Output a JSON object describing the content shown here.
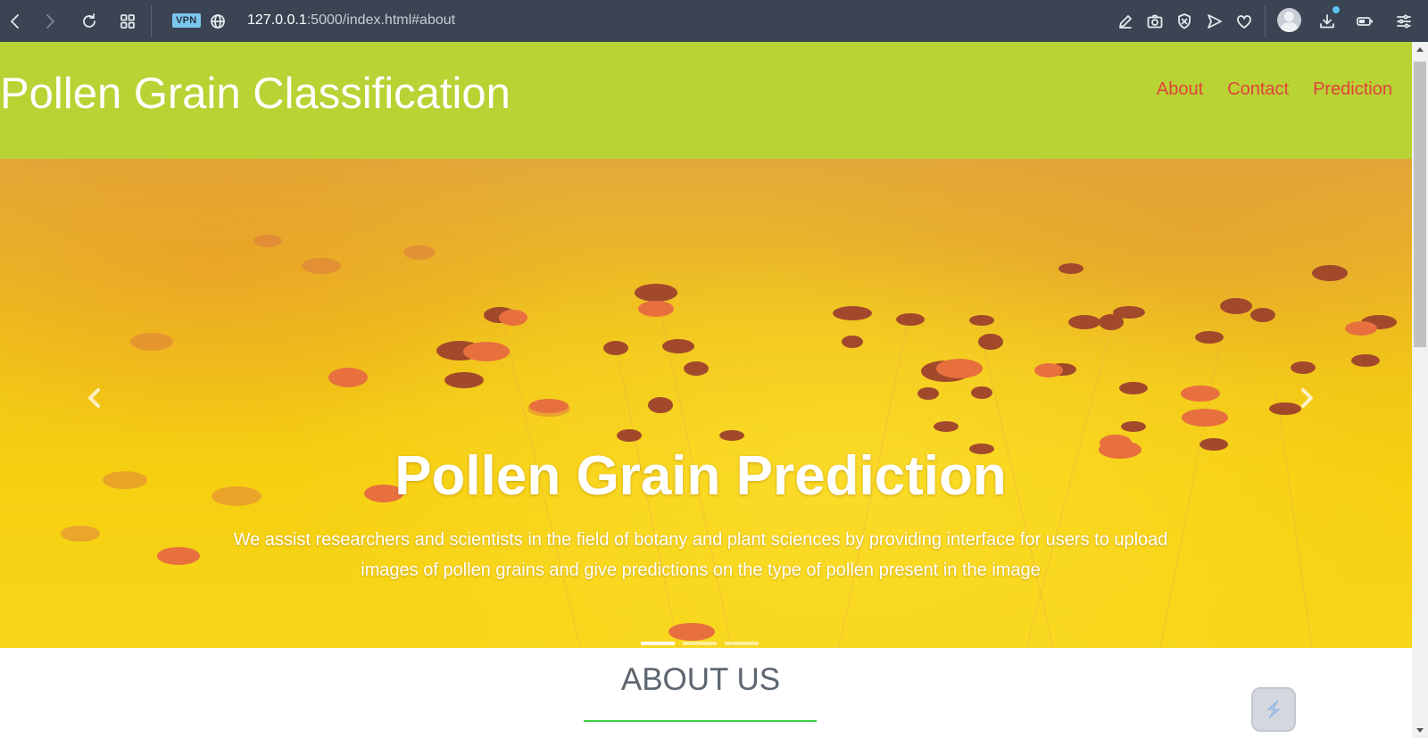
{
  "browser": {
    "vpn_label": "VPN",
    "url_host": "127.0.0.1",
    "url_rest": ":5000/index.html#about",
    "icons": [
      "back-icon",
      "forward-icon",
      "reload-icon",
      "tabs-grid-icon",
      "globe-icon",
      "edit-icon",
      "camera-icon",
      "shield-icon",
      "send-icon",
      "heart-icon",
      "avatar",
      "download-icon",
      "battery-icon",
      "settings-icon"
    ]
  },
  "site": {
    "brand": "Pollen Grain Classification",
    "nav": [
      "About",
      "Contact",
      "Prediction"
    ]
  },
  "hero": {
    "title": "Pollen Grain Prediction",
    "description": "We assist researchers and scientists in the field of botany and plant sciences by providing interface for users to upload images of pollen grains and give predictions on the type of pollen present in the image",
    "slide_count": 3,
    "active_slide": 1
  },
  "about": {
    "title": "ABOUT US"
  },
  "colors": {
    "header_bg": "#b9d234",
    "nav_link": "#e0433b",
    "underline": "#3fcc3f",
    "browser_bar": "#3a4452"
  }
}
